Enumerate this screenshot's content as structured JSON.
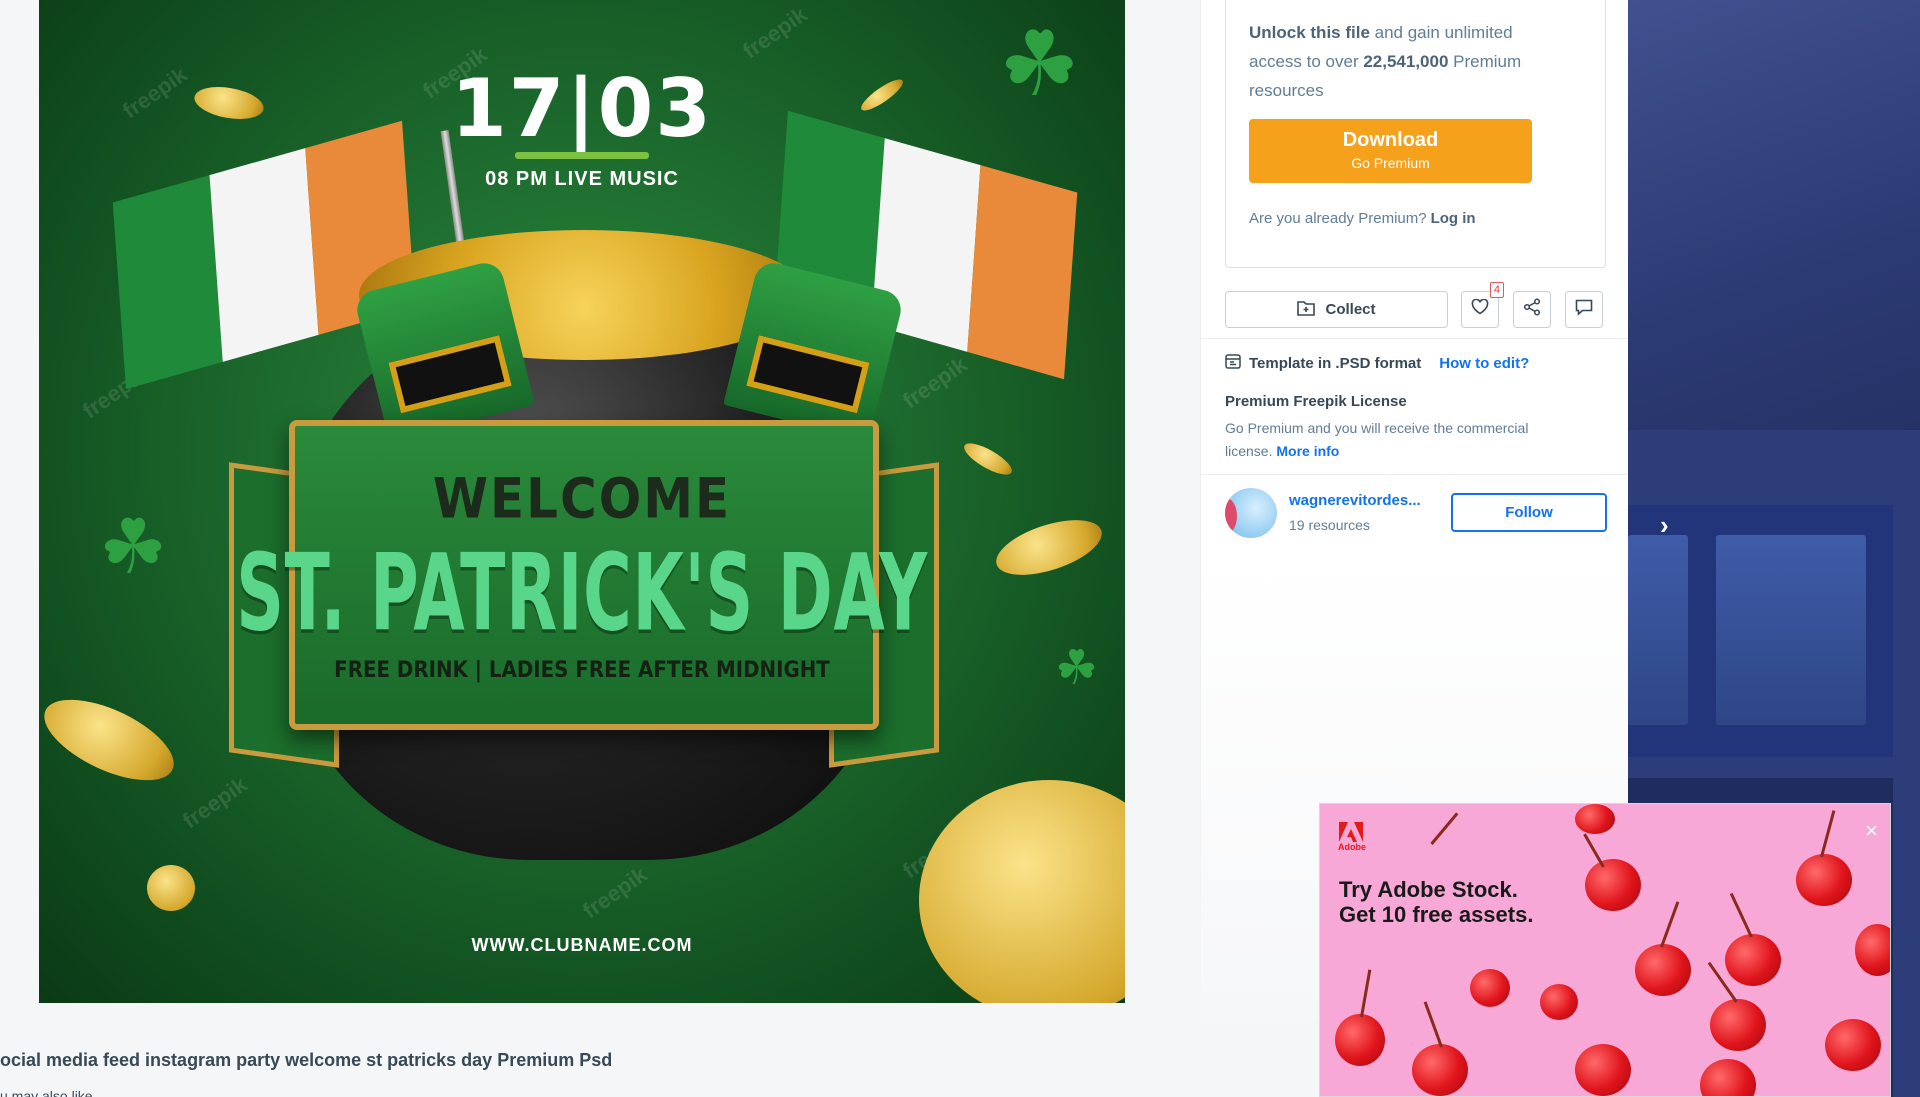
{
  "poster": {
    "date": "17|03",
    "subtitle": "08 PM LIVE MUSIC",
    "welcome": "WELCOME",
    "title": "ST. PATRICK'S DAY",
    "tagline": "FREE DRINK | LADIES FREE AFTER MIDNIGHT",
    "url": "WWW.CLUBNAME.COM",
    "watermark": "freepik",
    "colors": {
      "green": "#1d6b2e",
      "accent_green": "#5ad68a",
      "gold": "#d4a82c"
    }
  },
  "caption": "ocial media feed instagram party welcome st patricks day Premium Psd",
  "caption2": "u may also like",
  "premium": {
    "unlock_bold": "Unlock this file",
    "unlock_rest": " and gain unlimited access to over ",
    "count": "22,541,000",
    "resources": " Premium resources",
    "download_label": "Download",
    "download_sub": "Go Premium",
    "already_text": "Are you already Premium?",
    "login_label": "Log in",
    "accent_color": "#f5a11c"
  },
  "actions": {
    "collect_label": "Collect",
    "like_count": "4",
    "icons": [
      "folder-plus-icon",
      "heart-icon",
      "share-icon",
      "comment-icon"
    ]
  },
  "details": {
    "template_text": "Template in .PSD format",
    "how_to_edit": "How to edit?",
    "license_title": "Premium Freepik License",
    "license_text": "Go Premium and you will receive the commercial license.",
    "more_info": "More info"
  },
  "author": {
    "name": "wagnerevitordes...",
    "resources": "19 resources",
    "follow_label": "Follow"
  },
  "ad": {
    "brand": "Adobe",
    "headline": "Try Adobe Stock.\nGet 10 free assets.",
    "close_label": "×"
  },
  "nav": {
    "next_arrow": "›"
  }
}
